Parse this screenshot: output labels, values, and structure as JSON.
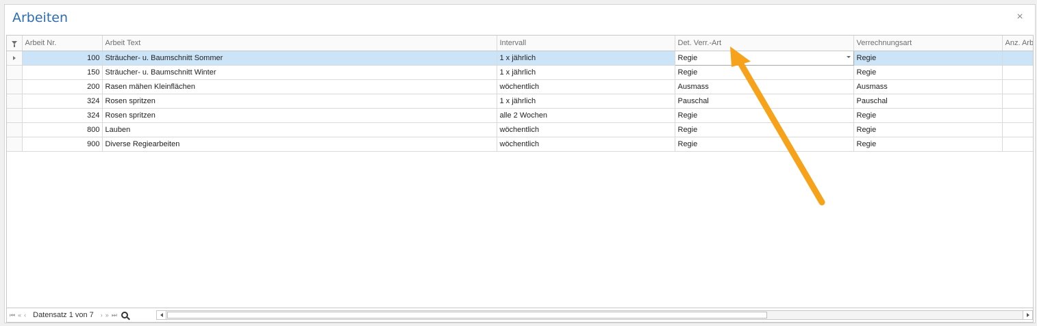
{
  "window": {
    "title": "Arbeiten",
    "close_glyph": "×"
  },
  "grid": {
    "columns": [
      "Arbeit Nr.",
      "Arbeit Text",
      "Intervall",
      "Det. Verr.-Art",
      "Verrechnungsart",
      "Anz. Arb"
    ],
    "rows": [
      [
        "100",
        "Sträucher- u. Baumschnitt Sommer",
        "1 x jährlich",
        "Regie",
        "Regie"
      ],
      [
        "150",
        "Sträucher- u. Baumschnitt Winter",
        "1 x jährlich",
        "Regie",
        "Regie"
      ],
      [
        "200",
        "Rasen mähen Kleinflächen",
        "wöchentlich",
        "Ausmass",
        "Ausmass"
      ],
      [
        "324",
        "Rosen spritzen",
        "1 x jährlich",
        "Pauschal",
        "Pauschal"
      ],
      [
        "324",
        "Rosen spritzen",
        "alle 2 Wochen",
        "Regie",
        "Regie"
      ],
      [
        "800",
        "Lauben",
        "wöchentlich",
        "Regie",
        "Regie"
      ],
      [
        "900",
        "Diverse Regiearbeiten",
        "wöchentlich",
        "Regie",
        "Regie"
      ]
    ]
  },
  "footer": {
    "record_text": "Datensatz 1 von 7",
    "nav_first": "⏮",
    "nav_prev_page": "«",
    "nav_prev": "‹",
    "nav_next": "›",
    "nav_next_page": "»",
    "nav_last": "⏭"
  },
  "colors": {
    "accent": "#2b6cb3",
    "selection": "#cce4f7",
    "annotation_arrow": "#f7a21b"
  },
  "icons": [
    "filter-icon",
    "row-indicator-icon",
    "dropdown-caret-icon",
    "search-icon",
    "close-icon"
  ]
}
